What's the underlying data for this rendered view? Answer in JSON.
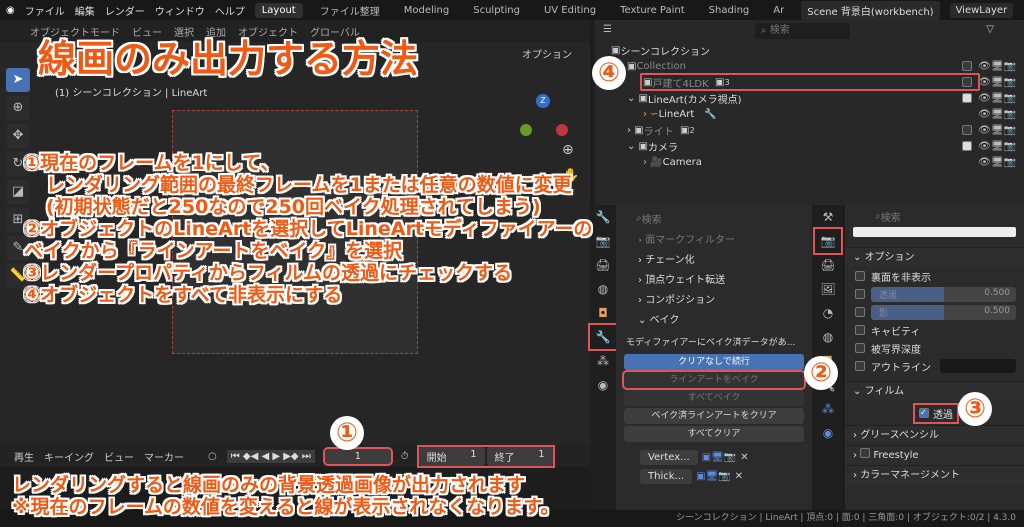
{
  "topbar": {
    "menus": [
      "ファイル",
      "編集",
      "レンダー",
      "ウィンドウ",
      "ヘルプ"
    ],
    "tabs": [
      "Layout",
      "ファイル整理",
      "Modeling",
      "Sculpting",
      "UV Editing",
      "Texture Paint",
      "Shading",
      "Ar"
    ],
    "active_tab": "Layout",
    "scene": "Scene 背景白(workbench)",
    "view_layer": "ViewLayer"
  },
  "viewport": {
    "header": [
      "オブジェクトモード",
      "ビュー",
      "選択",
      "追加",
      "オブジェクト",
      "グローバル"
    ],
    "options": "オプション",
    "breadcrumb": "(1) シーンコレクション | LineArt"
  },
  "outliner": {
    "search_placeholder": "検索",
    "rows": [
      {
        "label": "シーンコレクション"
      },
      {
        "label": "Collection"
      },
      {
        "label": "戸建て4LDK",
        "badge": "3"
      },
      {
        "label": "LineArt(カメラ視点)"
      },
      {
        "label": "LineArt"
      },
      {
        "label": "ライト",
        "badge": "2"
      },
      {
        "label": "カメラ"
      },
      {
        "label": "Camera"
      }
    ]
  },
  "modifier_panel": {
    "search_placeholder": "検索",
    "items": [
      "面マークフィルター",
      "チェーン化",
      "頂点ウェイト転送",
      "コンポジション",
      "ベイク"
    ],
    "bake_message": "モディファイアーにベイク済データがあ...",
    "buttons": [
      "クリアなしで続行",
      "ラインアートをベイク",
      "すべてベイク",
      "ベイク済ラインアートをクリア",
      "すべてクリア"
    ],
    "modifiers": [
      "Vertex...",
      "Thick..."
    ]
  },
  "render_panel": {
    "search_placeholder": "検索",
    "options_header": "オプション",
    "options": {
      "backface": "裏面を非表示",
      "transparency": "透過",
      "transparency_value": "0.500",
      "shadow": "影",
      "shadow_value": "0.500",
      "cavity": "キャビティ",
      "dof": "被写界深度",
      "outline": "アウトライン"
    },
    "film_header": "フィルム",
    "film_transparent": "透過",
    "film_transparent_checked": true,
    "sections": [
      "グリースペンシル",
      "Freestyle",
      "カラーマネージメント"
    ]
  },
  "timeline": {
    "menus": [
      "再生",
      "キーイング",
      "ビュー",
      "マーカー"
    ],
    "current_frame": "1",
    "start_label": "開始",
    "start": "1",
    "end_label": "終了",
    "end": "1"
  },
  "status": "シーンコレクション | LineArt | 頂点:0 | 面:0 | 三角面:0 | オブジェクト:0/2 | 4.3.0",
  "annotation": {
    "title": "線画のみ出力する方法",
    "steps": [
      "①現在のフレームを1にして、",
      "レンダリング範囲の最終フレームを1または任意の数値に変更",
      "(初期状態だと250なので250回ベイク処理されてしまう)",
      "②オブジェクトのLineArtを選択してLineArtモディファイアーの",
      "ベイクから『ラインアートをベイク』を選択",
      "③レンダープロパティからフィルムの透過にチェックする",
      "④オブジェクトをすべて非表示にする"
    ],
    "footer": [
      "レンダリングすると線画のみの背景透過画像が出力されます",
      "※現在のフレームの数値を変えると線が表示されなくなります。"
    ],
    "markers": [
      "①",
      "②",
      "③",
      "④"
    ]
  },
  "colors": {
    "accent": "#4772b3",
    "annotation": "#f05a14",
    "highlight": "#e0555a"
  }
}
